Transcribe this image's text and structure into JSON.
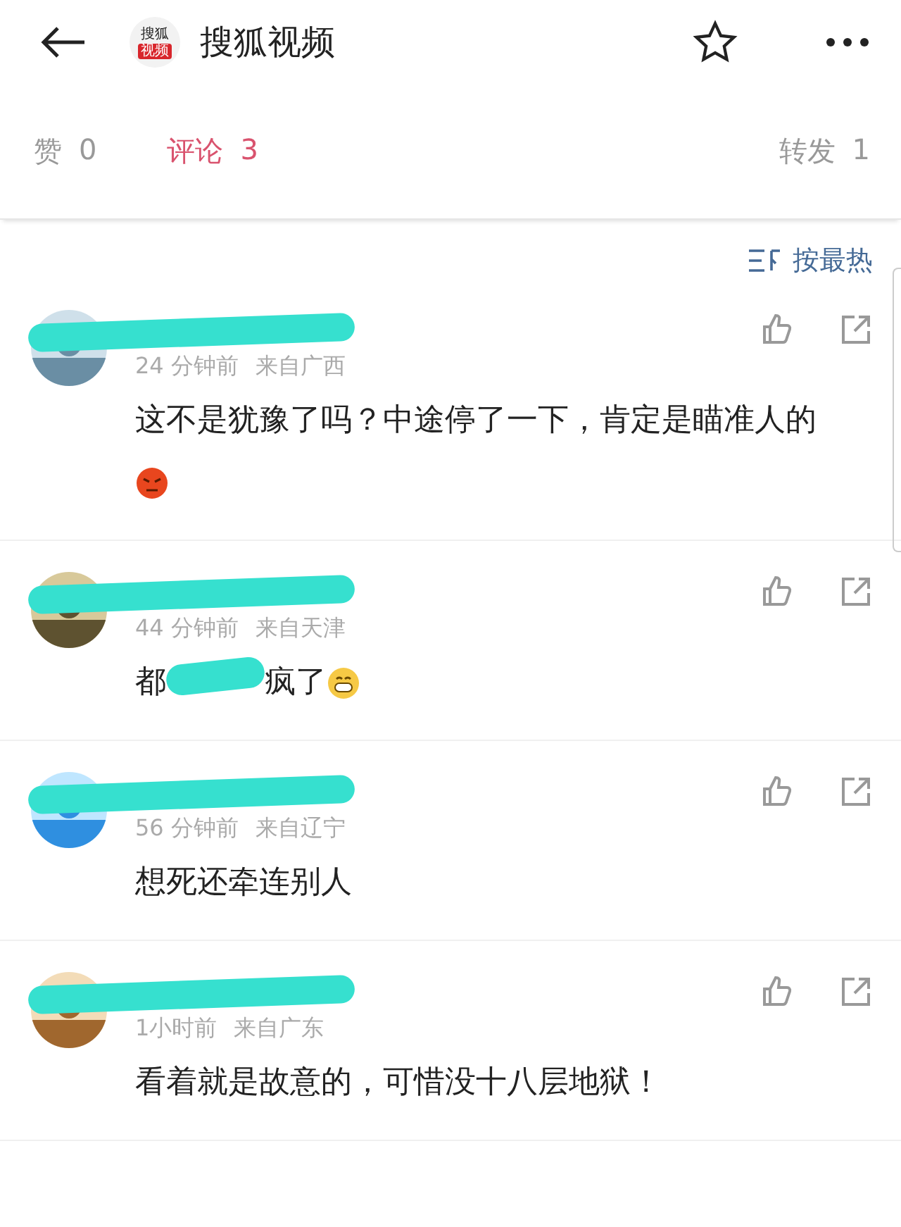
{
  "header": {
    "title": "搜狐视频",
    "logo_top": "搜狐",
    "logo_bottom": "视频"
  },
  "tabs": [
    {
      "label": "赞",
      "count": "0",
      "selected": false
    },
    {
      "label": "评论",
      "count": "3",
      "selected": true
    },
    {
      "label": "转发",
      "count": "1",
      "selected": false
    }
  ],
  "sort": {
    "label": "按最热"
  },
  "comments": [
    {
      "kind": "angry",
      "time": "24 分钟前",
      "location": "来自广西",
      "text": "这不是犹豫了吗？中途停了一下，肯定是瞄准人的"
    },
    {
      "kind": "grin",
      "time": "44 分钟前",
      "location": "来自天津",
      "text": "都",
      "text_after": "疯了"
    },
    {
      "kind": "plain",
      "time": "56 分钟前",
      "location": "来自辽宁",
      "text": "想死还牵连别人"
    },
    {
      "kind": "plain",
      "time": "1小时前",
      "location": "来自广东",
      "text": "看着就是故意的，可惜没十八层地狱！"
    }
  ]
}
